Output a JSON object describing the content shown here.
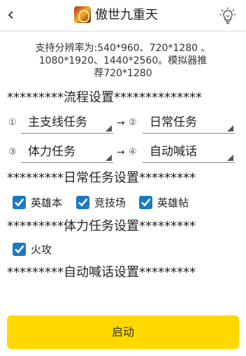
{
  "header": {
    "title": "傲世九重天"
  },
  "support_text_lines": [
    "支持分辨率为:540*960、720*1280 、",
    "1080*1920、1440*2560。模拟器推",
    "荐720*1280"
  ],
  "sections": {
    "flow": "*********流程设置**************",
    "daily": "*********日常任务设置*********",
    "stamina": "*********体力任务设置*********",
    "shout": "*********自动喊话设置*********"
  },
  "flow": {
    "num1": "①",
    "num2": "②",
    "num3": "③",
    "num4": "④",
    "arrow": "→",
    "slot1": "主支线任务",
    "slot2": "日常任务",
    "slot3": "体力任务",
    "slot4": "自动喊话"
  },
  "daily_tasks": [
    {
      "label": "英雄本",
      "checked": true
    },
    {
      "label": "竞技场",
      "checked": true
    },
    {
      "label": "英雄帖",
      "checked": true
    }
  ],
  "stamina_tasks": [
    {
      "label": "火攻",
      "checked": true
    }
  ],
  "start_button": "启动",
  "colors": {
    "accent": "#1b79c4",
    "button": "#ffd800"
  }
}
